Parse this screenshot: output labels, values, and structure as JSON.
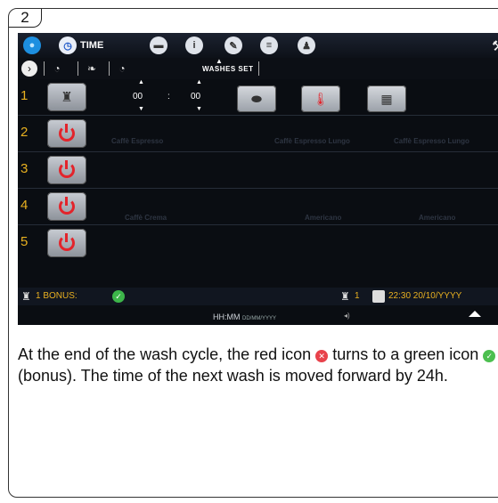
{
  "step_number": "2",
  "tabs": {
    "time_label": "TIME"
  },
  "subbar": {
    "washes_set": "WASHES SET"
  },
  "rows": [
    {
      "number": "1",
      "hours": "00",
      "colon": ":",
      "minutes": "00"
    },
    {
      "number": "2",
      "faint": [
        "Caffè Espresso",
        "Caffè Espresso Lungo",
        "Caffè Espresso Lungo"
      ]
    },
    {
      "number": "3"
    },
    {
      "number": "4",
      "faint": [
        "Caffè Crema",
        "Americano",
        "Americano"
      ]
    },
    {
      "number": "5"
    }
  ],
  "status": {
    "bonus_label": "1 BONUS:",
    "counter": "1",
    "datetime": "22:30 20/10/YYYY"
  },
  "hint": {
    "time_format": "HH:MM",
    "date_format": "DD/MM/YYYY"
  },
  "caption": {
    "part1": "At the end of the wash cycle, the red icon ",
    "part2": " turns to a green icon ",
    "part3": " (bonus). The time of the next wash is moved forward by 24h."
  },
  "colors": {
    "accent": "#e8b020",
    "power_red": "#e3242b",
    "ok_green": "#3db54a"
  }
}
